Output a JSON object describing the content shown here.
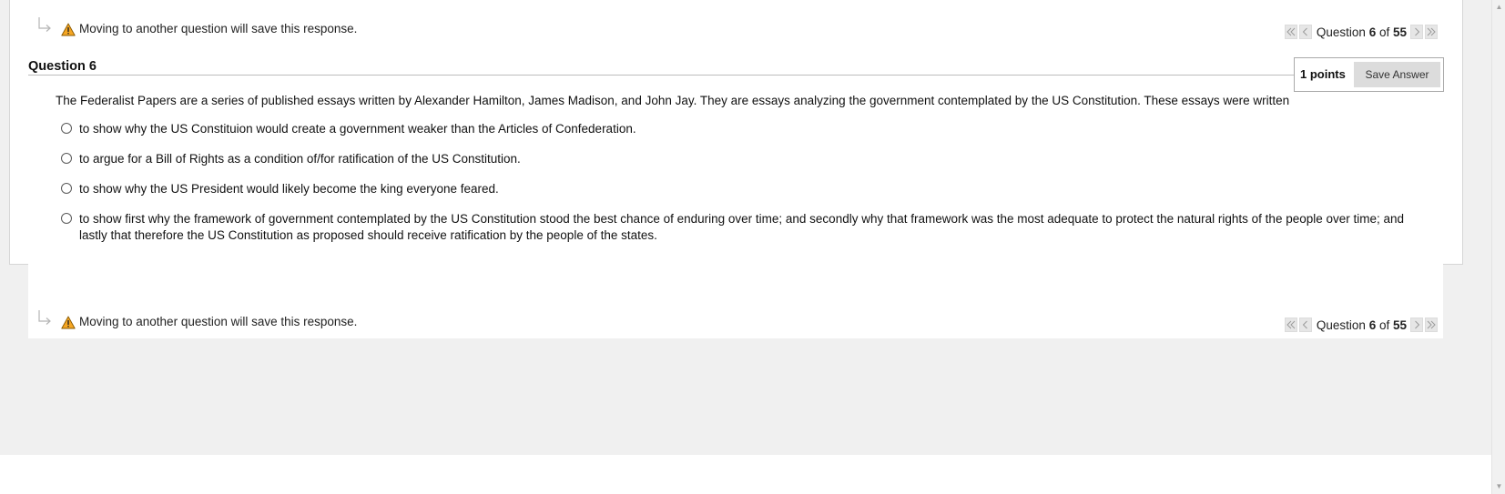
{
  "notice": {
    "warning_text": "Moving to another question will save this response.",
    "icon": "warning-icon",
    "indent_icon": "indent-arrow-icon"
  },
  "pager": {
    "prefix": "Question ",
    "current": "6",
    "of_text": " of ",
    "total": "55",
    "first_icon": "double-chevron-left-icon",
    "prev_icon": "chevron-left-icon",
    "next_icon": "chevron-right-icon",
    "last_icon": "double-chevron-right-icon"
  },
  "question": {
    "title": "Question 6",
    "points": "1 points",
    "save_label": "Save Answer",
    "prompt": "The Federalist Papers are a series of published essays written by Alexander Hamilton, James Madison, and John Jay.  They are essays analyzing the government contemplated by the US Constitution.   These essays were written",
    "options": [
      "to show why the US Constituion would create a government weaker than the Articles of Confederation.",
      "to argue for a Bill of Rights as a condition of/for ratification of the US Constitution.",
      "to show why the US President would likely become the king everyone feared.",
      "to show first why the framework of government contemplated by the US Constitution stood the best chance of enduring over time; and secondly why that framework was the most adequate to protect the natural rights of the people over time; and lastly that therefore the US Constitution as proposed should receive ratification by the people of the states."
    ],
    "selected_index": null
  },
  "colors": {
    "page_background": "#f0f0f0",
    "panel_background": "#ffffff",
    "warning_fill": "#f5a623",
    "button_gray": "#dcdcdc"
  }
}
